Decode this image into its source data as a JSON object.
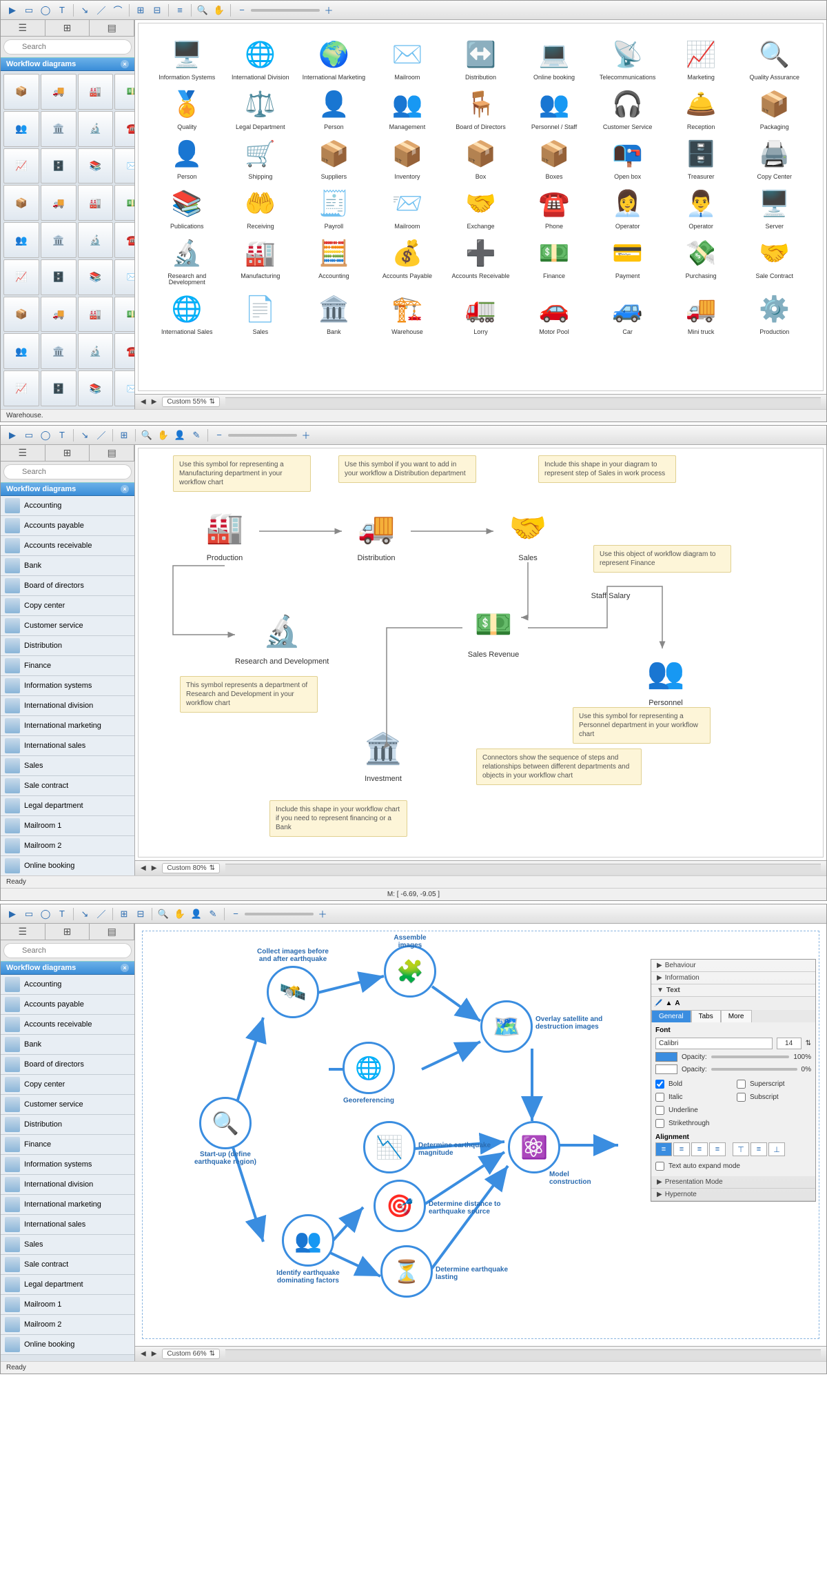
{
  "search_placeholder": "Search",
  "sidebar_title": "Workflow diagrams",
  "app1": {
    "zoom": "Custom 55%",
    "status": "Warehouse.",
    "icons": [
      {
        "g": "🖥️",
        "l": "Information Systems"
      },
      {
        "g": "🌐",
        "l": "International Division"
      },
      {
        "g": "🌍",
        "l": "International Marketing"
      },
      {
        "g": "✉️",
        "l": "Mailroom"
      },
      {
        "g": "↔️",
        "l": "Distribution"
      },
      {
        "g": "💻",
        "l": "Online booking"
      },
      {
        "g": "📡",
        "l": "Telecommunications"
      },
      {
        "g": "📈",
        "l": "Marketing"
      },
      {
        "g": "🔍",
        "l": "Quality Assurance"
      },
      {
        "g": "🏅",
        "l": "Quality"
      },
      {
        "g": "⚖️",
        "l": "Legal Department"
      },
      {
        "g": "👤",
        "l": "Person"
      },
      {
        "g": "👥",
        "l": "Management"
      },
      {
        "g": "🪑",
        "l": "Board of Directors"
      },
      {
        "g": "👥",
        "l": "Personnel / Staff"
      },
      {
        "g": "🎧",
        "l": "Customer Service"
      },
      {
        "g": "🛎️",
        "l": "Reception"
      },
      {
        "g": "📦",
        "l": "Packaging"
      },
      {
        "g": "👤",
        "l": "Person"
      },
      {
        "g": "🛒",
        "l": "Shipping"
      },
      {
        "g": "📦",
        "l": "Suppliers"
      },
      {
        "g": "📦",
        "l": "Inventory"
      },
      {
        "g": "📦",
        "l": "Box"
      },
      {
        "g": "📦",
        "l": "Boxes"
      },
      {
        "g": "📭",
        "l": "Open box"
      },
      {
        "g": "🗄️",
        "l": "Treasurer"
      },
      {
        "g": "🖨️",
        "l": "Copy Center"
      },
      {
        "g": "📚",
        "l": "Publications"
      },
      {
        "g": "🤲",
        "l": "Receiving"
      },
      {
        "g": "🧾",
        "l": "Payroll"
      },
      {
        "g": "📨",
        "l": "Mailroom"
      },
      {
        "g": "🤝",
        "l": "Exchange"
      },
      {
        "g": "☎️",
        "l": "Phone"
      },
      {
        "g": "👩‍💼",
        "l": "Operator"
      },
      {
        "g": "👨‍💼",
        "l": "Operator"
      },
      {
        "g": "🖥️",
        "l": "Server"
      },
      {
        "g": "🔬",
        "l": "Research and Development"
      },
      {
        "g": "🏭",
        "l": "Manufacturing"
      },
      {
        "g": "🧮",
        "l": "Accounting"
      },
      {
        "g": "💰",
        "l": "Accounts Payable"
      },
      {
        "g": "➕",
        "l": "Accounts Receivable"
      },
      {
        "g": "💵",
        "l": "Finance"
      },
      {
        "g": "💳",
        "l": "Payment"
      },
      {
        "g": "💸",
        "l": "Purchasing"
      },
      {
        "g": "🤝",
        "l": "Sale Contract"
      },
      {
        "g": "🌐",
        "l": "International Sales"
      },
      {
        "g": "📄",
        "l": "Sales"
      },
      {
        "g": "🏛️",
        "l": "Bank"
      },
      {
        "g": "🏗️",
        "l": "Warehouse"
      },
      {
        "g": "🚛",
        "l": "Lorry"
      },
      {
        "g": "🚗",
        "l": "Motor Pool"
      },
      {
        "g": "🚙",
        "l": "Car"
      },
      {
        "g": "🚚",
        "l": "Mini truck"
      },
      {
        "g": "⚙️",
        "l": "Production"
      }
    ]
  },
  "sidebar_list": [
    "Accounting",
    "Accounts payable",
    "Accounts receivable",
    "Bank",
    "Board of directors",
    "Copy center",
    "Customer service",
    "Distribution",
    "Finance",
    "Information systems",
    "International division",
    "International marketing",
    "International sales",
    "Sales",
    "Sale contract",
    "Legal department",
    "Mailroom 1",
    "Mailroom 2",
    "Online booking"
  ],
  "app2": {
    "zoom": "Custom 80%",
    "status": "Ready",
    "ruler_m": "M: [ -6.69, -9.05 ]",
    "nodes": {
      "production": "Production",
      "distribution": "Distribution",
      "sales": "Sales",
      "rd": "Research and Development",
      "staff": "Staff Salary",
      "revenue": "Sales Revenue",
      "personnel": "Personnel",
      "investment": "Investment"
    },
    "notes": {
      "n1": "Use this symbol for representing a Manufacturing department in your workflow chart",
      "n2": "Use this symbol if you want to add in your workflow a Distribution department",
      "n3": "Include this shape in your diagram to represent step of Sales in work process",
      "n4": "Use this object of workflow diagram to represent Finance",
      "n5": "This symbol represents a department of Research and Development in your workflow chart",
      "n6": "Use this symbol for representing a Personnel department in your workflow chart",
      "n7": "Connectors show the sequence of steps and relationships between different departments and objects in your workflow chart",
      "n8": "Include this shape in your workflow chart if you need to represent financing or a Bank"
    }
  },
  "app3": {
    "zoom": "Custom 66%",
    "status": "Ready",
    "nodes": {
      "startup": "Start-up (define earthquake region)",
      "collect": "Collect images before and after earthquake",
      "assemble": "Assemble images",
      "overlay": "Overlay satellite and destruction images",
      "georef": "Georeferencing",
      "magnitude": "Determine earthquake magnitude",
      "distance": "Determine distance to earthquake source",
      "lasting": "Determine earthquake lasting",
      "factors": "Identify earthquake dominating factors",
      "model": "Model construction"
    },
    "props": {
      "sections": [
        "Behaviour",
        "Information",
        "Text"
      ],
      "tabs": [
        "General",
        "Tabs",
        "More"
      ],
      "font_label": "Font",
      "font_name": "Calibri",
      "font_size": "14",
      "opacity_label": "Opacity:",
      "opacity1": "100%",
      "opacity0": "0%",
      "styles": [
        "Bold",
        "Italic",
        "Underline",
        "Strikethrough",
        "Superscript",
        "Subscript"
      ],
      "align_label": "Alignment",
      "auto_expand": "Text auto expand mode",
      "footer": [
        "Presentation Mode",
        "Hypernote"
      ]
    }
  }
}
